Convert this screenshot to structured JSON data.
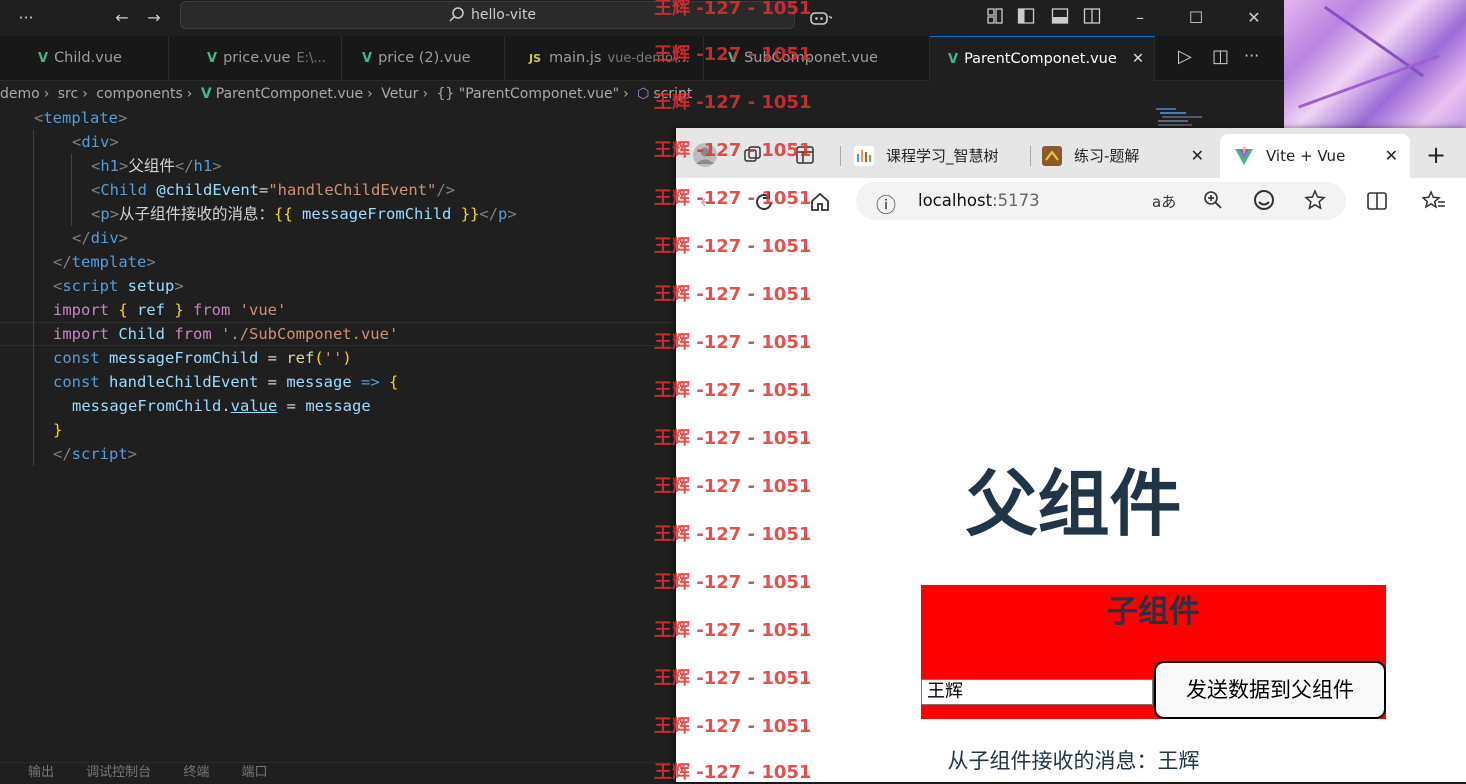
{
  "titlebar": {
    "dots": "···",
    "back_icon": "←",
    "forward_icon": "→",
    "search_text": "hello-vite",
    "window_min": "–",
    "window_max": "☐",
    "window_close": "✕"
  },
  "tabs": [
    {
      "label": "Child.vue",
      "sub": ""
    },
    {
      "label": "price.vue",
      "sub": "E:\\..."
    },
    {
      "label": "price (2).vue",
      "sub": ""
    },
    {
      "label": "main.js",
      "sub": "vue-demo\\..."
    },
    {
      "label": "SubComponet.vue",
      "sub": ""
    },
    {
      "label": "ParentComponet.vue",
      "sub": ""
    }
  ],
  "tab_js_badge": "JS",
  "tab_close": "✕",
  "editor_actions": {
    "run": "▷",
    "split": "◫",
    "more": "···"
  },
  "breadcrumbs": {
    "items": [
      "demo",
      "src",
      "components",
      "ParentComponet.vue",
      "Vetur",
      "{} \"ParentComponet.vue\"",
      "script"
    ],
    "sep": "›"
  },
  "code": {
    "l1": {
      "lt": "<",
      "tag": "template",
      "gt": ">"
    },
    "l2": {
      "lt": "<",
      "tag": "div",
      "gt": ">"
    },
    "l3": {
      "lt": "<",
      "tag": "h1",
      "gt": ">",
      "text": "父组件",
      "lt2": "</",
      "tag2": "h1",
      "gt2": ">"
    },
    "l4": {
      "lt": "<",
      "tag": "Child",
      "attr": " @childEvent",
      "eq": "=",
      "val": "\"handleChildEvent\"",
      "end": "/>"
    },
    "l5": {
      "lt": "<",
      "tag": "p",
      "gt": ">",
      "text": "从子组件接收的消息：",
      "m1": "{{",
      "var": " messageFromChild ",
      "m2": "}}",
      "lt2": "</",
      "tag2": "p",
      "gt2": ">"
    },
    "l6": {
      "lt": "</",
      "tag": "div",
      "gt": ">"
    },
    "l7": {
      "lt": "</",
      "tag": "template",
      "gt": ">"
    },
    "l8": {
      "lt": "<",
      "tag": "script",
      "attr": " setup",
      "gt": ">"
    },
    "l9": {
      "kw": "import",
      "b1": " { ",
      "id": "ref",
      "b2": " } ",
      "from": "from",
      "str": " 'vue'"
    },
    "l10": {
      "kw": "import",
      "id": " Child ",
      "from": "from",
      "str": " './SubComponet.vue'"
    },
    "l11": {
      "kw": "const",
      "id": " messageFromChild ",
      "eq": "= ",
      "fn": "ref",
      "p1": "(",
      "str": "''",
      "p2": ")"
    },
    "l12": {
      "kw": "const",
      "id": " handleChildEvent ",
      "eq": "= ",
      "arg": "message",
      "arrow": " => ",
      "b": "{"
    },
    "l13": {
      "obj": "messageFromChild",
      "dot": ".",
      "prop": "value",
      "eq": " = ",
      "rhs": "message"
    },
    "l14": {
      "b": "}"
    },
    "l15": {
      "lt": "</",
      "tag": "script",
      "gt": ">"
    }
  },
  "bottom_panel": [
    "输出",
    "调试控制台",
    "终端",
    "端口"
  ],
  "browser": {
    "tabs": [
      {
        "label": "课程学习_智慧树"
      },
      {
        "label": "练习-题解"
      },
      {
        "label": "Vite + Vue"
      }
    ],
    "tab_close": "✕",
    "new_tab": "+",
    "url_host": "localhost",
    "url_port": ":5173",
    "info_icon": "ⓘ",
    "read_aloud": "aあ"
  },
  "app": {
    "title": "父组件",
    "child_title": "子组件",
    "input_value": "王辉",
    "send_button": "发送数据到父组件",
    "received_label": "从子组件接收的消息：",
    "received_value": "王辉"
  },
  "watermark": {
    "text": "王辉 -127 - 1051"
  },
  "colors": {
    "child_bg": "#ff0000",
    "heading": "#213547",
    "watermark": "#e03030",
    "vue_green": "#41b883",
    "accent": "#0078d4"
  }
}
